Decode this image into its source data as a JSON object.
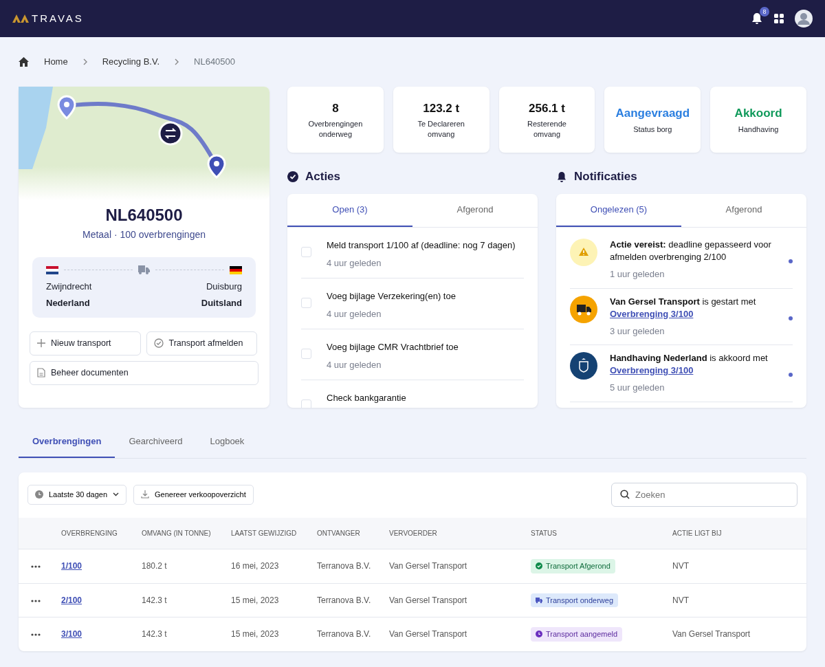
{
  "header": {
    "logo": "TRAVAS",
    "notification_count": "8"
  },
  "breadcrumb": [
    "Home",
    "Recycling B.V.",
    "NL640500"
  ],
  "shipment": {
    "id": "NL640500",
    "subtitle": "Metaal · 100 overbrengingen",
    "origin": {
      "city": "Zwijndrecht",
      "country": "Nederland"
    },
    "destination": {
      "city": "Duisburg",
      "country": "Duitsland"
    },
    "buttons": [
      {
        "label": "Nieuw transport"
      },
      {
        "label": "Transport afmelden"
      },
      {
        "label": "Beheer documenten"
      }
    ]
  },
  "stats": [
    {
      "value": "8",
      "label": "Overbrengingen onderweg",
      "color": "#111111"
    },
    {
      "value": "123.2 t",
      "label": "Te Declareren omvang",
      "color": "#111111"
    },
    {
      "value": "256.1 t",
      "label": "Resterende omvang",
      "color": "#111111"
    },
    {
      "value": "Aangevraagd",
      "label": "Status borg",
      "color": "#2b7fe0"
    },
    {
      "value": "Akkoord",
      "label": "Handhaving",
      "color": "#109a5b"
    }
  ],
  "actions": {
    "title": "Acties",
    "tabs": [
      {
        "label": "Open (3)",
        "selected": true
      },
      {
        "label": "Afgerond",
        "selected": false
      }
    ],
    "items": [
      {
        "text": "Meld transport 1/100 af (deadline: nog 7 dagen)",
        "time": "4 uur geleden",
        "checked": false
      },
      {
        "text": "Voeg bijlage Verzekering(en) toe",
        "time": "4 uur geleden",
        "checked": false
      },
      {
        "text": "Voeg bijlage CMR Vrachtbrief toe",
        "time": "4 uur geleden",
        "checked": false
      },
      {
        "text": "Check bankgarantie",
        "checked": false
      }
    ]
  },
  "notifications": {
    "title": "Notificaties",
    "tabs": [
      {
        "label": "Ongelezen (5)",
        "selected": true
      },
      {
        "label": "Afgerond",
        "selected": false
      }
    ],
    "items": [
      {
        "kind": "warning",
        "text": "**Actie vereist:** deadline gepasseerd voor afmelden overbrenging 2/100",
        "time": "1 uur geleden",
        "unread": true
      },
      {
        "kind": "carrier",
        "text": "**Van Gersel Transport** is gestart met",
        "link": "Overbrenging 3/100",
        "time": "3 uur geleden",
        "unread": true
      },
      {
        "kind": "authority",
        "text": "**Handhaving Nederland** is akkoord met",
        "link": "Overbrenging 3/100",
        "time": "5 uur geleden",
        "unread": true
      }
    ]
  },
  "tabs": [
    {
      "label": "Overbrengingen",
      "selected": true
    },
    {
      "label": "Gearchiveerd",
      "selected": false
    },
    {
      "label": "Logboek",
      "selected": false
    }
  ],
  "toolbar": {
    "period": "Laatste 30 dagen",
    "export": "Genereer verkoopoverzicht",
    "search_placeholder": "Zoeken"
  },
  "table": {
    "columns": [
      "OVERBRENGING",
      "OMVANG (IN TONNE)",
      "LAATST GEWIJZIGD",
      "ONTVANGER",
      "VERVOERDER",
      "STATUS",
      "ACTIE LIGT BIJ"
    ],
    "rows": [
      {
        "id": "1/100",
        "amount": "180.2 t",
        "modified": "16 mei, 2023",
        "receiver": "Terranova B.V.",
        "carrier": "Van Gersel Transport",
        "status": {
          "kind": "done",
          "label": "Transport Afgerond"
        },
        "action_by": "NVT"
      },
      {
        "id": "2/100",
        "amount": "142.3 t",
        "modified": "15 mei, 2023",
        "receiver": "Terranova B.V.",
        "carrier": "Van Gersel Transport",
        "status": {
          "kind": "transit",
          "label": "Transport onderweg"
        },
        "action_by": "NVT"
      },
      {
        "id": "3/100",
        "amount": "142.3 t",
        "modified": "15 mei, 2023",
        "receiver": "Terranova B.V.",
        "carrier": "Van Gersel Transport",
        "status": {
          "kind": "registered",
          "label": "Transport aangemeld"
        },
        "action_by": "Van Gersel Transport"
      }
    ]
  }
}
